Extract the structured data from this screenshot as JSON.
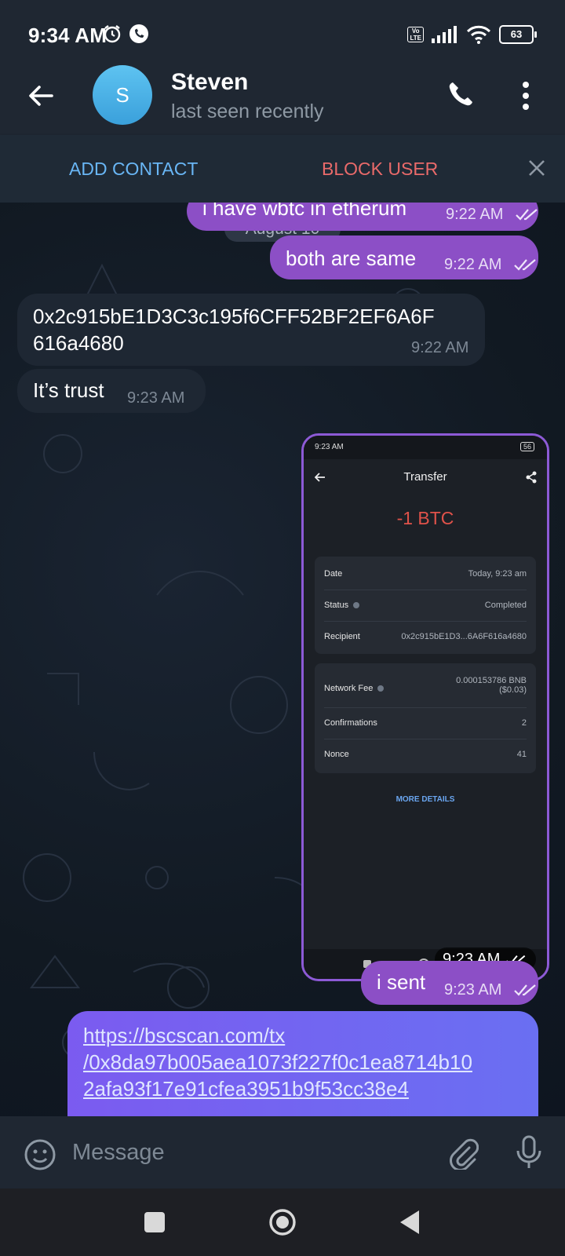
{
  "status_bar": {
    "time": "9:34 AM",
    "battery": "63",
    "volte": "Vo\nLTE"
  },
  "header": {
    "avatar_letter": "S",
    "name": "Steven",
    "status": "last seen recently"
  },
  "action_bar": {
    "add_contact": "ADD CONTACT",
    "block_user": "BLOCK USER"
  },
  "chat": {
    "date_chip": "August 10",
    "messages": [
      {
        "dir": "out",
        "text": "i have wbtc in etherum",
        "time": "9:22 AM",
        "read": true
      },
      {
        "dir": "out",
        "text": "both are same",
        "time": "9:22 AM",
        "read": true
      },
      {
        "dir": "in",
        "text_line1": "0x2c915bE1D3C3c195f6CFF52BF2EF6A6F",
        "text_line2": "616a4680",
        "time": "9:22 AM"
      },
      {
        "dir": "in",
        "text": "It’s trust",
        "time": "9:23 AM"
      },
      {
        "dir": "out",
        "type": "image",
        "time": "9:23 AM",
        "read": true
      },
      {
        "dir": "out",
        "text": "i sent",
        "time": "9:23 AM",
        "read": true
      },
      {
        "dir": "out",
        "type": "link",
        "line1": "https://bscscan.com/tx",
        "line2": "/0x8da97b005aea1073f227f0c1ea8714b10",
        "line3": "2afa93f17e91cfea3951b9f53cc38e4"
      }
    ]
  },
  "screenshot": {
    "status_time": "9:23 AM",
    "battery": "56",
    "title": "Transfer",
    "amount": "-1 BTC",
    "details": [
      {
        "label": "Date",
        "value": "Today, 9:23 am"
      },
      {
        "label": "Status",
        "value": "Completed"
      },
      {
        "label": "Recipient",
        "value": "0x2c915bE1D3...6A6F616a4680"
      }
    ],
    "fees": [
      {
        "label": "Network Fee",
        "value_line1": "0.000153786 BNB",
        "value_line2": "($0.03)"
      },
      {
        "label": "Confirmations",
        "value": "2"
      },
      {
        "label": "Nonce",
        "value": "41"
      }
    ],
    "more_details": "MORE DETAILS"
  },
  "composer": {
    "placeholder": "Message"
  },
  "colors": {
    "outgoing": "#8c4fc6",
    "incoming": "#1e2733",
    "accent": "#69b6f5",
    "danger": "#e96a6a"
  }
}
